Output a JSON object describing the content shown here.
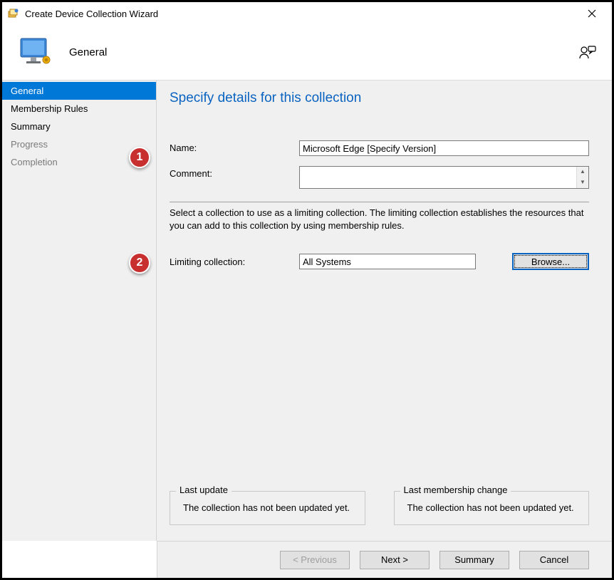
{
  "window": {
    "title": "Create Device Collection Wizard"
  },
  "header": {
    "title": "General"
  },
  "sidebar": {
    "items": [
      {
        "label": "General",
        "state": "selected",
        "interactable": true
      },
      {
        "label": "Membership Rules",
        "state": "normal",
        "interactable": true
      },
      {
        "label": "Summary",
        "state": "normal",
        "interactable": true
      },
      {
        "label": "Progress",
        "state": "disabled",
        "interactable": false
      },
      {
        "label": "Completion",
        "state": "disabled",
        "interactable": false
      }
    ]
  },
  "main": {
    "page_title": "Specify details for this collection",
    "name_label": "Name:",
    "name_value": "Microsoft Edge [Specify Version]",
    "comment_label": "Comment:",
    "comment_value": "",
    "hint_text": "Select a collection to use as a limiting collection. The limiting collection establishes the resources that you can add to this collection by using membership rules.",
    "limiting_label": "Limiting collection:",
    "limiting_value": "All Systems",
    "browse_label": "Browse...",
    "last_update": {
      "legend": "Last update",
      "text": "The collection has not been updated yet."
    },
    "last_membership": {
      "legend": "Last membership change",
      "text": "The collection has not been updated yet."
    }
  },
  "buttons": {
    "previous": "< Previous",
    "next": "Next >",
    "summary": "Summary",
    "cancel": "Cancel"
  },
  "callouts": {
    "one": "1",
    "two": "2"
  }
}
